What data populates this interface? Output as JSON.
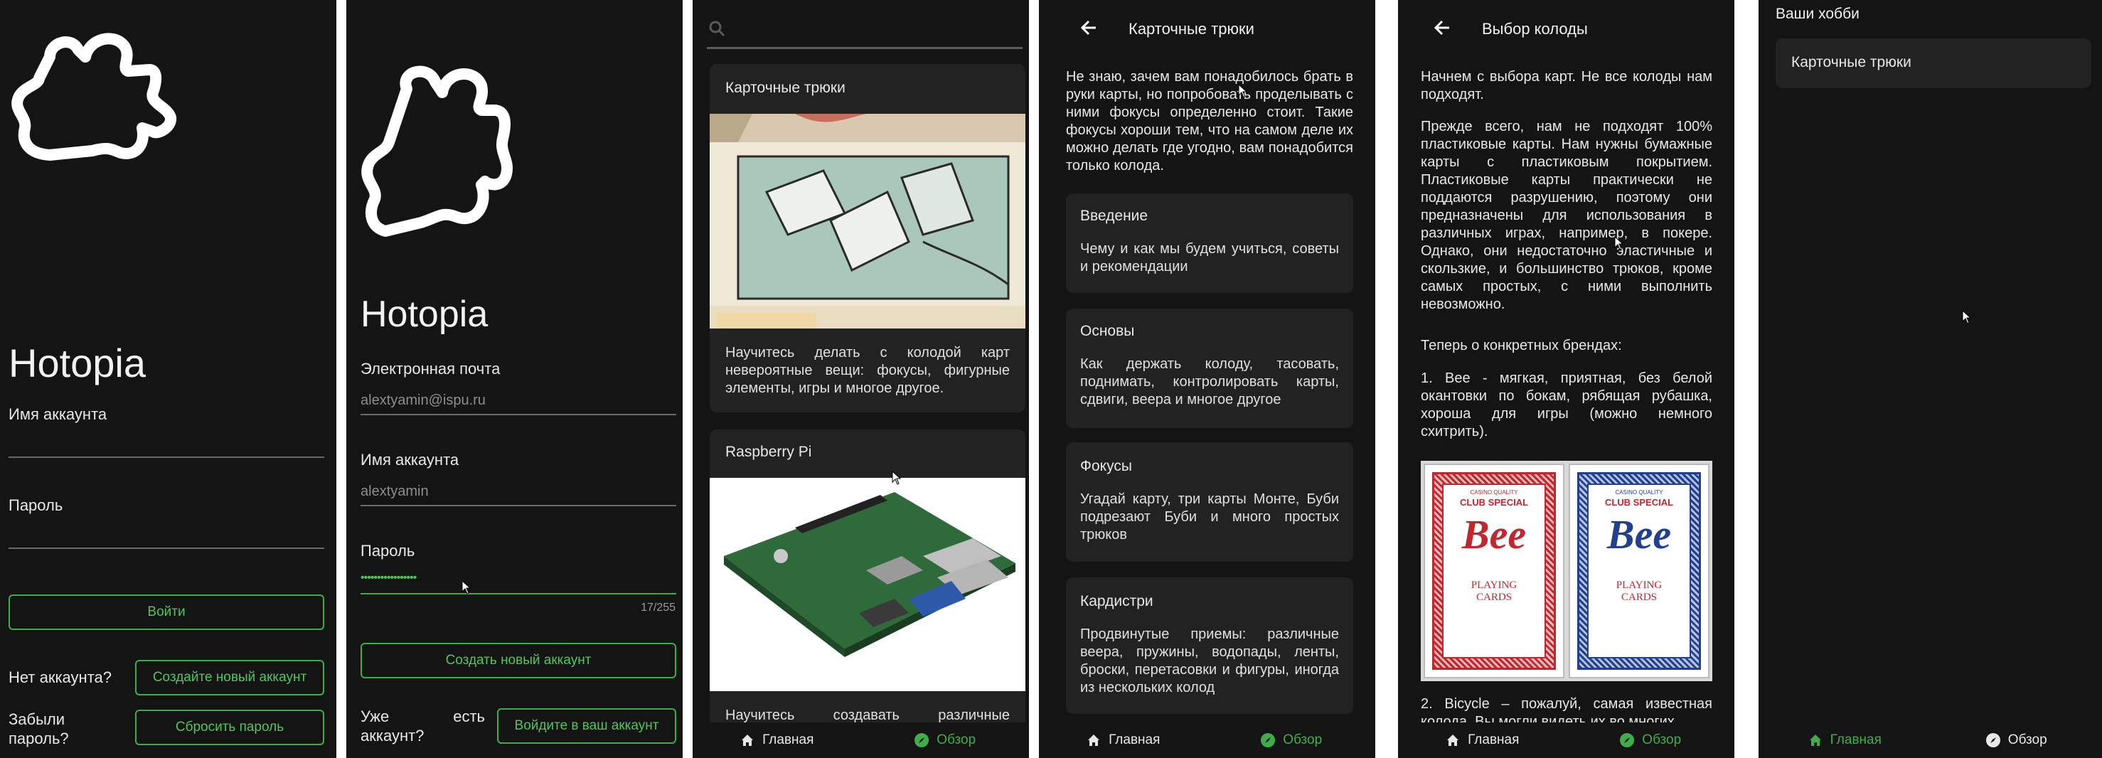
{
  "login": {
    "app_name": "Hotopia",
    "account_label": "Имя аккаунта",
    "password_label": "Пароль",
    "login_button": "Войти",
    "no_account_text": "Нет аккаунта?",
    "create_account_button": "Создайте новый аккаунт",
    "forgot_password_text": "Забыли пароль?",
    "reset_password_button": "Сбросить пароль"
  },
  "register": {
    "app_name": "Hotopia",
    "email_label": "Электронная почта",
    "email_value": "alextyamin@ispu.ru",
    "account_label": "Имя аккаунта",
    "account_value": "alextyamin",
    "password_label": "Пароль",
    "password_value": "•••••••••••••••••",
    "password_counter": "17/255",
    "create_button": "Создать новый аккаунт",
    "have_account_text_1": "Уже",
    "have_account_text_2": "есть",
    "have_account_text_3": "аккаунт?",
    "login_link_button": "Войдите в ваш аккаунт"
  },
  "overview": {
    "search_placeholder": "",
    "cards": [
      {
        "title": "Карточные трюки",
        "description": "Научитесь делать с колодой карт невероятные вещи: фокусы, фигурные элементы, игры и многое другое."
      },
      {
        "title": "Raspberry Pi",
        "description": "Научитесь создавать различные"
      }
    ]
  },
  "hobby": {
    "title": "Карточные трюки",
    "intro": "Не знаю, зачем вам понадобилось брать в руки карты, но попробовать проделывать с ними фокусы определенно стоит. Такие фокусы хороши тем, что на самом деле их можно делать где угодно, вам понадобится только колода.",
    "sections": [
      {
        "title": "Введение",
        "text": "Чему и как мы будем учиться, советы и рекомендации"
      },
      {
        "title": "Основы",
        "text": "Как держать колоду, тасовать, поднимать, контролировать карты, сдвиги, веера и многое другое"
      },
      {
        "title": "Фокусы",
        "text": "Угадай карту, три карты Монте, Буби подрезают Буби и много простых трюков"
      },
      {
        "title": "Кардистри",
        "text": "Продвинутые приемы: различные веера, пружины, водопады, ленты, броски, перетасовки и фигуры, иногда из нескольких колод"
      }
    ]
  },
  "deck": {
    "title": "Выбор колоды",
    "p1": "Начнем с выбора карт. Не все колоды нам подходят.",
    "p2": "Прежде всего, нам не подходят 100% пластиковые карты. Нам нужны бумажные карты с пластиковым покрытием. Пластиковые карты практически не поддаются разрушению, поэтому они предназначены для использования в различных играх, например, в покере. Однако, они недостаточно эластичные и скользкие, и большинство трюков, кроме самых простых, с ними выполнить невозможно.",
    "p3": "Теперь о конкретных брендах:",
    "p4": "1. Bee - мягкая, приятная, без белой окантовки по бокам, рябящая рубашка, хороша для игры (можно немного схитрить).",
    "p5": "2. Bicycle – пожалуй, самая известная колода. Вы могли видеть их во многих",
    "card_brand": "Bee",
    "card_top": "CASINO QUALITY",
    "card_club": "CLUB SPECIAL",
    "card_bottom_1": "PLAYING",
    "card_bottom_2": "CARDS"
  },
  "my_hobbies": {
    "header": "Ваши хобби",
    "items": [
      "Карточные трюки"
    ]
  },
  "nav": {
    "home": "Главная",
    "overview": "Обзор"
  },
  "colors": {
    "background": "#141414",
    "card": "#222222",
    "accent_green": "#3fae4a"
  }
}
